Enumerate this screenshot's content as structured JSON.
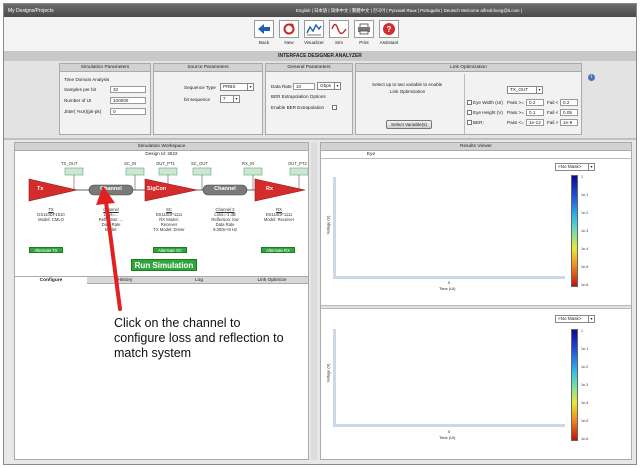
{
  "window": {
    "title": "My Designs/Projects",
    "lang_bar": "English | 日本語 | 简体中文 | 繁體中文 | 한국어 | Русский Язык | Português | Deutsch   Welcome  alfredchong@ti.com  |"
  },
  "toolbar": {
    "buttons": [
      {
        "label": "Back",
        "icon": "back-arrow-icon"
      },
      {
        "label": "New",
        "icon": "refresh-icon"
      },
      {
        "label": "Visualizer",
        "icon": "chart-icon"
      },
      {
        "label": "Sim",
        "icon": "waveform-icon"
      },
      {
        "label": "Print",
        "icon": "printer-icon"
      },
      {
        "label": "Assistant",
        "icon": "help-icon"
      }
    ]
  },
  "app_title": "INTERFACE DESIGNER ANALYZER",
  "sim_params": {
    "header": "Simulation Parameters",
    "analysis": "Time Domain Analysis",
    "samples_label": "Samples per bit",
    "samples_value": "32",
    "ui_label": "Number of UI",
    "ui_value": "100000",
    "jitter_label": "Jitter( %UI)(pk-pk)",
    "jitter_value": "0"
  },
  "source_params": {
    "header": "Source Parameters",
    "seq_label": "Sequence Type",
    "seq_value": "PRBS",
    "bitseq_label": "bit sequence",
    "bitseq_value": "7"
  },
  "general_params": {
    "header": "General Parameters",
    "rate_label": "Data Rate",
    "rate_value": "10",
    "rate_unit": "Gbps",
    "ber_opts": "BER Extrapolation Options",
    "ber_enable": "Enable BER Extrapolation"
  },
  "link_opt": {
    "header": "Link Optimization",
    "desc1": "Select up to two variable to enable",
    "desc2": "Link Optimization",
    "select_btn": "Select Variable(s)",
    "target": "TX_OUT",
    "rows": [
      {
        "label": "Eye Width (UI)",
        "pass_label": "Pass >=",
        "pass": "0.2",
        "fail_label": "Fail <",
        "fail": "0.2"
      },
      {
        "label": "Eye Height (V)",
        "pass_label": "Pass >=",
        "pass": "0.1",
        "fail_label": "Fail <",
        "fail": "0.05"
      },
      {
        "label": "BER:",
        "pass_label": "Pass <=",
        "pass": "1e-12",
        "fail_label": "Fail >",
        "fail": "1e-9"
      }
    ]
  },
  "workspace": {
    "header": "Simulation Workspace",
    "design_id": "Design Id: 2622",
    "probes": [
      "TX_OUT",
      "SC_IN",
      "OUT_PT1",
      "SC_OUT",
      "RX_IN",
      "OUT_PT2"
    ],
    "components": [
      {
        "name": "Tx",
        "type": "triangle",
        "lines": [
          "TX",
          "DS110DF1610",
          "Model: CMLO"
        ]
      },
      {
        "name": "Channel",
        "type": "pill",
        "lines": [
          "Channel",
          "Loss=...",
          "Reflection: ...",
          "Data Rate",
          "Model:"
        ]
      },
      {
        "name": "SigCon",
        "type": "triangle",
        "lines": [
          "SC",
          "DS110DF1111",
          "RX Model:",
          "Receiver",
          "TX Model: Driver"
        ]
      },
      {
        "name": "Channel",
        "type": "pill",
        "lines": [
          "Channel 2",
          "Loss=-1 dB",
          "Reflection: low",
          "Data Rate",
          "9.300e+9 Hz"
        ]
      },
      {
        "name": "Rx",
        "type": "triangle",
        "lines": [
          "RX",
          "DS110DF1111",
          "Model: Receiver"
        ]
      }
    ],
    "alt_buttons": [
      "Alternate TX",
      "Alternate SC",
      "Alternate RX"
    ],
    "run_button": "Run Simulation",
    "tabs": [
      "Configure",
      "History",
      "Log",
      "Link Optimize"
    ]
  },
  "results": {
    "header": "Results Viewer",
    "tab": "Eye",
    "mask_value": "<No Mask>",
    "ylabel": "Voltage (V)",
    "xlabel": "Time (UI)",
    "xtick": "0",
    "colorbar_ticks": [
      "1",
      "1e-1",
      "1e-2",
      "1e-3",
      "1e-4",
      "1e-5",
      "1e-6"
    ]
  },
  "annotation": {
    "text": "Click on the channel to configure loss and reflection to match system",
    "arrow_color": "#e32020"
  },
  "colors": {
    "tx_red": "#d42b2b",
    "channel_gray": "#7a7a7a",
    "run_green": "#2fa53a"
  }
}
